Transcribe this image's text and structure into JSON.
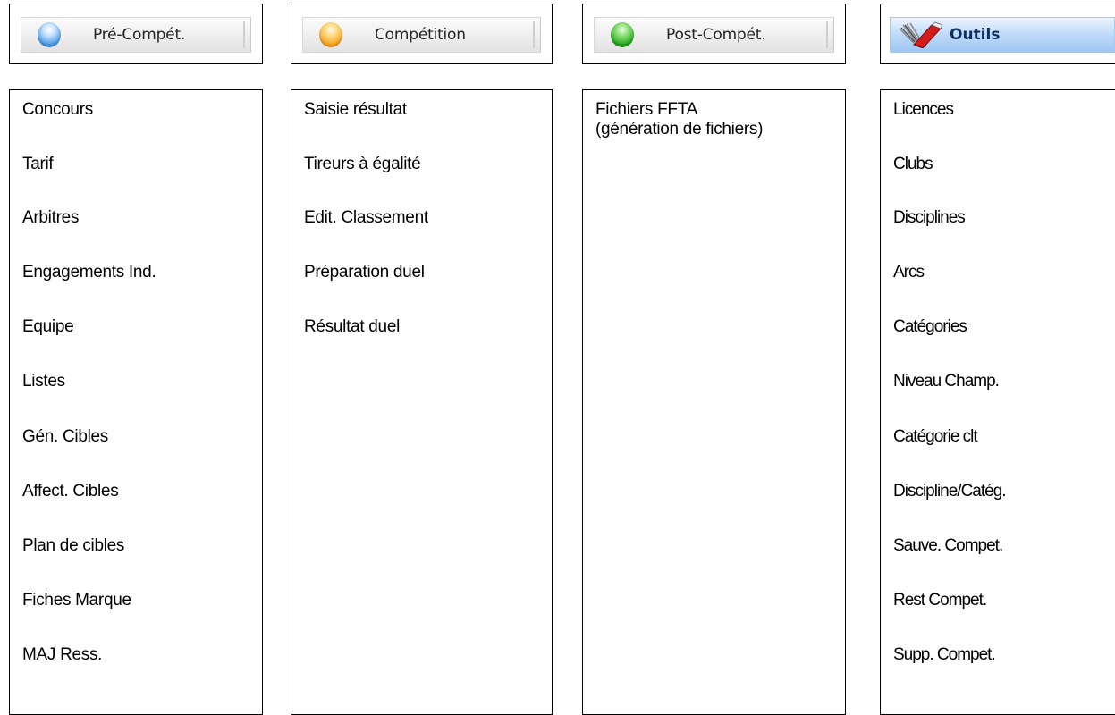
{
  "tabs": {
    "pre": {
      "label": "Pré-Compét."
    },
    "comp": {
      "label": "Compétition"
    },
    "post": {
      "label": "Post-Compét."
    },
    "tools": {
      "label": "Outils"
    }
  },
  "columns": {
    "pre": {
      "items": [
        "Concours",
        "Tarif",
        "Arbitres",
        "Engagements Ind.",
        "Equipe",
        "Listes",
        "Gén. Cibles",
        "Affect. Cibles",
        "Plan de cibles",
        "Fiches Marque",
        "MAJ Ress."
      ]
    },
    "comp": {
      "items": [
        "Saisie résultat",
        "Tireurs à égalité",
        "Edit. Classement",
        "Préparation duel",
        "Résultat duel"
      ]
    },
    "post": {
      "items": [
        "Fichiers FFTA",
        "(génération de fichiers)"
      ]
    },
    "tools": {
      "items": [
        "Licences",
        "Clubs",
        "Disciplines",
        "Arcs",
        "Catégories",
        "Niveau Champ.",
        "Catégorie clt",
        "Discipline/Catég.",
        "Sauve. Compet.",
        "Rest Compet.",
        "Supp. Compet."
      ]
    }
  },
  "colors": {
    "border": "#000000",
    "tools_tab_bg": "#bfdaf8",
    "tools_label": "#10315e"
  },
  "icons": {
    "pre": "blue-orb-icon",
    "comp": "orange-orb-icon",
    "post": "green-orb-icon",
    "tools": "tools-icon"
  }
}
